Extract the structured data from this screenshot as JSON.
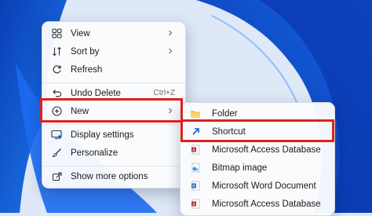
{
  "context_menu": {
    "items": [
      {
        "label": "View",
        "icon": "grid-icon",
        "has_submenu": true
      },
      {
        "label": "Sort by",
        "icon": "sort-icon",
        "has_submenu": true
      },
      {
        "label": "Refresh",
        "icon": "refresh-icon"
      },
      {
        "label": "Undo Delete",
        "icon": "undo-icon",
        "shortcut": "Ctrl+Z"
      },
      {
        "label": "New",
        "icon": "plus-circle-icon",
        "has_submenu": true
      },
      {
        "label": "Display settings",
        "icon": "display-icon"
      },
      {
        "label": "Personalize",
        "icon": "brush-icon"
      },
      {
        "label": "Show more options",
        "icon": "share-icon"
      }
    ]
  },
  "submenu": {
    "items": [
      {
        "label": "Folder",
        "icon": "folder-icon"
      },
      {
        "label": "Shortcut",
        "icon": "shortcut-icon"
      },
      {
        "label": "Microsoft Access Database",
        "icon": "access-icon"
      },
      {
        "label": "Bitmap image",
        "icon": "bitmap-icon"
      },
      {
        "label": "Microsoft Word Document",
        "icon": "word-icon"
      },
      {
        "label": "Microsoft Access Database",
        "icon": "access-icon"
      }
    ]
  },
  "colors": {
    "highlight": "#e0201e",
    "accent": "#0a63d8",
    "folder": "#f0c244"
  }
}
